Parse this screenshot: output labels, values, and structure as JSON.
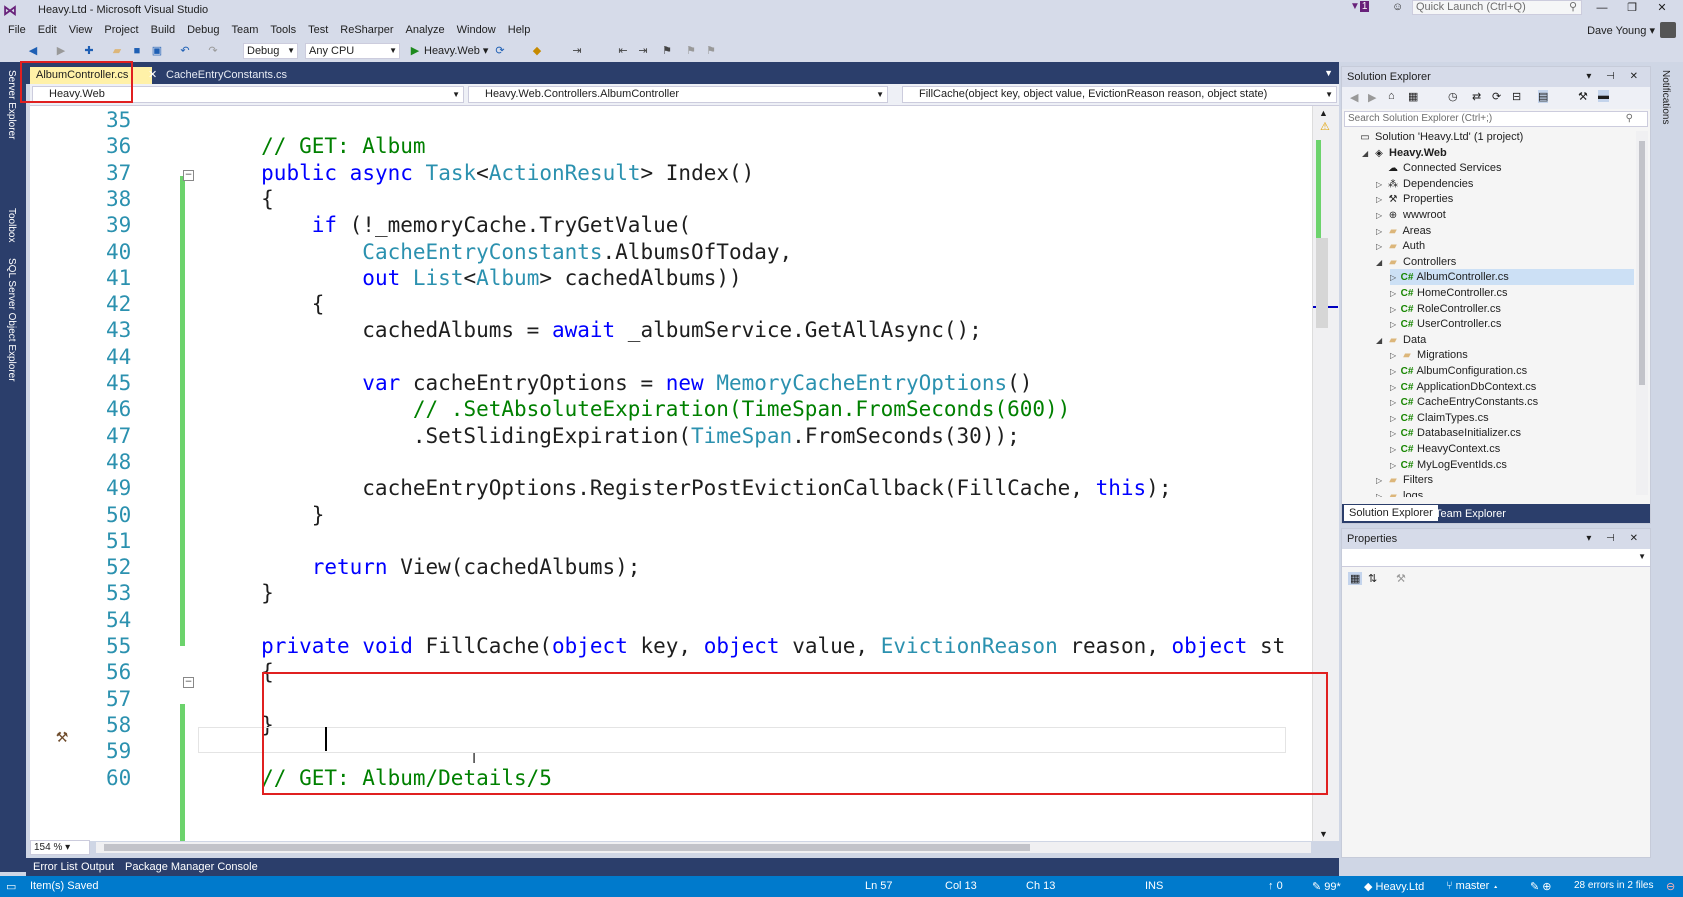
{
  "window": {
    "title": "Heavy.Ltd - Microsoft Visual Studio",
    "quick_launch_placeholder": "Quick Launch (Ctrl+Q)",
    "user": "Dave Young",
    "notification_count": "1"
  },
  "menu": [
    "File",
    "Edit",
    "View",
    "Project",
    "Build",
    "Debug",
    "Team",
    "Tools",
    "Test",
    "ReSharper",
    "Analyze",
    "Window",
    "Help"
  ],
  "toolbar": {
    "configuration": "Debug",
    "platform": "Any CPU",
    "run_target": "Heavy.Web"
  },
  "left_strip": [
    "Server Explorer",
    "Toolbox",
    "SQL Server Object Explorer"
  ],
  "editor_tabs": [
    {
      "label": "AlbumController.cs",
      "active": true
    },
    {
      "label": "CacheEntryConstants.cs",
      "active": false
    }
  ],
  "nav": {
    "project": "Heavy.Web",
    "class": "Heavy.Web.Controllers.AlbumController",
    "member": "FillCache(object key, object value, EvictionReason reason, object state)"
  },
  "code_lines": [
    {
      "n": "35",
      "text": ""
    },
    {
      "n": "36",
      "text": "        // GET: Album"
    },
    {
      "n": "37",
      "text": "        public async Task<ActionResult> Index()"
    },
    {
      "n": "38",
      "text": "        {"
    },
    {
      "n": "39",
      "text": "            if (!_memoryCache.TryGetValue("
    },
    {
      "n": "40",
      "text": "                CacheEntryConstants.AlbumsOfToday,"
    },
    {
      "n": "41",
      "text": "                out List<Album> cachedAlbums))"
    },
    {
      "n": "42",
      "text": "            {"
    },
    {
      "n": "43",
      "text": "                cachedAlbums = await _albumService.GetAllAsync();"
    },
    {
      "n": "44",
      "text": ""
    },
    {
      "n": "45",
      "text": "                var cacheEntryOptions = new MemoryCacheEntryOptions()"
    },
    {
      "n": "46",
      "text": "                    // .SetAbsoluteExpiration(TimeSpan.FromSeconds(600))"
    },
    {
      "n": "47",
      "text": "                    .SetSlidingExpiration(TimeSpan.FromSeconds(30));"
    },
    {
      "n": "48",
      "text": ""
    },
    {
      "n": "49",
      "text": "                cacheEntryOptions.RegisterPostEvictionCallback(FillCache, this);"
    },
    {
      "n": "50",
      "text": "            }"
    },
    {
      "n": "51",
      "text": ""
    },
    {
      "n": "52",
      "text": "            return View(cachedAlbums);"
    },
    {
      "n": "53",
      "text": "        }"
    },
    {
      "n": "54",
      "text": ""
    },
    {
      "n": "55",
      "text": "        private void FillCache(object key, object value, EvictionReason reason, object st"
    },
    {
      "n": "56",
      "text": "        {"
    },
    {
      "n": "57",
      "text": ""
    },
    {
      "n": "58",
      "text": "        }"
    },
    {
      "n": "59",
      "text": ""
    },
    {
      "n": "60",
      "text": "        // GET: Album/Details/5"
    }
  ],
  "zoom": "154 %",
  "solution_explorer": {
    "title": "Solution Explorer",
    "search_placeholder": "Search Solution Explorer (Ctrl+;)",
    "items": [
      {
        "label": "Solution 'Heavy.Ltd' (1 project)",
        "depth": 0,
        "icon": "solution-icon",
        "exp": ""
      },
      {
        "label": "Heavy.Web",
        "depth": 1,
        "icon": "web-project-icon",
        "exp": "◢"
      },
      {
        "label": "Connected Services",
        "depth": 2,
        "icon": "connected-services-icon",
        "exp": ""
      },
      {
        "label": "Dependencies",
        "depth": 2,
        "icon": "dependencies-icon",
        "exp": "▷"
      },
      {
        "label": "Properties",
        "depth": 2,
        "icon": "wrench-icon",
        "exp": "▷"
      },
      {
        "label": "wwwroot",
        "depth": 2,
        "icon": "globe-icon",
        "exp": "▷"
      },
      {
        "label": "Areas",
        "depth": 2,
        "icon": "folder-icon",
        "exp": "▷"
      },
      {
        "label": "Auth",
        "depth": 2,
        "icon": "folder-icon",
        "exp": "▷"
      },
      {
        "label": "Controllers",
        "depth": 2,
        "icon": "folder-icon",
        "exp": "◢"
      },
      {
        "label": "AlbumController.cs",
        "depth": 3,
        "icon": "csharp-file-icon",
        "exp": "▷",
        "selected": true
      },
      {
        "label": "HomeController.cs",
        "depth": 3,
        "icon": "csharp-file-icon",
        "exp": "▷"
      },
      {
        "label": "RoleController.cs",
        "depth": 3,
        "icon": "csharp-file-icon",
        "exp": "▷"
      },
      {
        "label": "UserController.cs",
        "depth": 3,
        "icon": "csharp-file-icon",
        "exp": "▷"
      },
      {
        "label": "Data",
        "depth": 2,
        "icon": "folder-icon",
        "exp": "◢"
      },
      {
        "label": "Migrations",
        "depth": 3,
        "icon": "folder-icon",
        "exp": "▷"
      },
      {
        "label": "AlbumConfiguration.cs",
        "depth": 3,
        "icon": "csharp-file-icon",
        "exp": "▷"
      },
      {
        "label": "ApplicationDbContext.cs",
        "depth": 3,
        "icon": "csharp-file-icon",
        "exp": "▷"
      },
      {
        "label": "CacheEntryConstants.cs",
        "depth": 3,
        "icon": "csharp-file-icon",
        "exp": "▷"
      },
      {
        "label": "ClaimTypes.cs",
        "depth": 3,
        "icon": "csharp-file-icon",
        "exp": "▷"
      },
      {
        "label": "DatabaseInitializer.cs",
        "depth": 3,
        "icon": "csharp-file-icon",
        "exp": "▷"
      },
      {
        "label": "HeavyContext.cs",
        "depth": 3,
        "icon": "csharp-file-icon",
        "exp": "▷"
      },
      {
        "label": "MyLogEventIds.cs",
        "depth": 3,
        "icon": "csharp-file-icon",
        "exp": "▷"
      },
      {
        "label": "Filters",
        "depth": 2,
        "icon": "folder-icon",
        "exp": "▷"
      },
      {
        "label": "logs",
        "depth": 2,
        "icon": "folder-icon",
        "exp": "▷"
      }
    ],
    "tabs": [
      "Solution Explorer",
      "Team Explorer"
    ]
  },
  "properties": {
    "title": "Properties"
  },
  "bottom_tabs": [
    "Error List",
    "Output",
    "Package Manager Console"
  ],
  "right_strip": "Notifications",
  "status": {
    "message": "Item(s) Saved",
    "ln": "Ln 57",
    "col": "Col 13",
    "ch": "Ch 13",
    "ins": "INS",
    "up": "0",
    "pencil": "99*",
    "repo": "Heavy.Ltd",
    "branch": "master",
    "errors": "28 errors in 2 files"
  },
  "colors": {
    "accent": "#007acc",
    "highlight_box": "#e02020",
    "keyword": "#0000ff",
    "type": "#2b91af",
    "comment": "#008000"
  }
}
